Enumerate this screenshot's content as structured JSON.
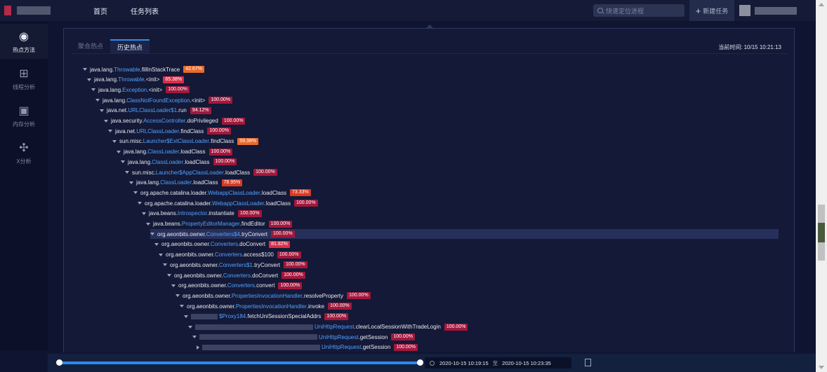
{
  "nav": {
    "home": "首页",
    "tasks": "任务列表"
  },
  "search": {
    "placeholder": "快速定位进程"
  },
  "new_task": "新建任务",
  "sidebar": [
    {
      "label": "热点方法",
      "icon": "hotspot-icon",
      "active": true
    },
    {
      "label": "线程分析",
      "icon": "thread-tree-icon",
      "active": false
    },
    {
      "label": "内存分析",
      "icon": "memory-icon",
      "active": false
    },
    {
      "label": "X分析",
      "icon": "x-analysis-icon",
      "active": false
    }
  ],
  "tabs": {
    "aggregate": "聚合热点",
    "history": "历史热点"
  },
  "current_time": {
    "label": "当前时间:",
    "value": "10/15 10:21:13"
  },
  "tree": [
    {
      "pre": "java.lang.",
      "cls": "Throwable",
      "m": ".fillInStackTrace",
      "pct": "42.67%",
      "color": "#e86a2c",
      "expanded": true
    },
    {
      "pre": "java.lang.",
      "cls": "Throwable",
      "m": ".<init>",
      "pct": "65.38%",
      "color": "#d92f4b",
      "expanded": true
    },
    {
      "pre": "java.lang.",
      "cls": "Exception",
      "m": ".<init>",
      "pct": "100.00%",
      "color": "#a2183c",
      "expanded": true
    },
    {
      "pre": "java.lang.",
      "cls": "ClassNotFoundException",
      "m": ".<init>",
      "pct": "100.00%",
      "color": "#a2183c",
      "expanded": true
    },
    {
      "pre": "java.net.",
      "cls": "URLClassLoader$1",
      "m": ".run",
      "pct": "94.12%",
      "color": "#a2183c",
      "expanded": true
    },
    {
      "pre": "java.security.",
      "cls": "AccessController",
      "m": ".doPrivileged",
      "pct": "100.00%",
      "color": "#a2183c",
      "expanded": true
    },
    {
      "pre": "java.net.",
      "cls": "URLClassLoader",
      "m": ".findClass",
      "pct": "100.00%",
      "color": "#a2183c",
      "expanded": true
    },
    {
      "pre": "sun.misc.",
      "cls": "Launcher$ExtClassLoader",
      "m": ".findClass",
      "pct": "59.38%",
      "color": "#e86a2c",
      "expanded": true
    },
    {
      "pre": "java.lang.",
      "cls": "ClassLoader",
      "m": ".loadClass",
      "pct": "100.00%",
      "color": "#a2183c",
      "expanded": true
    },
    {
      "pre": "java.lang.",
      "cls": "ClassLoader",
      "m": ".loadClass",
      "pct": "100.00%",
      "color": "#a2183c",
      "expanded": true
    },
    {
      "pre": "sun.misc.",
      "cls": "Launcher$AppClassLoader",
      "m": ".loadClass",
      "pct": "100.00%",
      "color": "#a2183c",
      "expanded": true
    },
    {
      "pre": "java.lang.",
      "cls": "ClassLoader",
      "m": ".loadClass",
      "pct": "78.95%",
      "color": "#d93a22",
      "expanded": true
    },
    {
      "pre": "org.apache.catalina.loader.",
      "cls": "WebappClassLoader",
      "m": ".loadClass",
      "pct": "73.33%",
      "color": "#d93a22",
      "expanded": true
    },
    {
      "pre": "org.apache.catalina.loader.",
      "cls": "WebappClassLoader",
      "m": ".loadClass",
      "pct": "100.00%",
      "color": "#a2183c",
      "expanded": true
    },
    {
      "pre": "java.beans.",
      "cls": "Introspector",
      "m": ".instantiate",
      "pct": "100.00%",
      "color": "#a2183c",
      "expanded": true
    },
    {
      "pre": "java.beans.",
      "cls": "PropertyEditorManager",
      "m": ".findEditor",
      "pct": "100.00%",
      "color": "#a2183c",
      "expanded": true
    },
    {
      "pre": "org.aeonbits.owner.",
      "cls": "Converters$4",
      "m": ".tryConvert",
      "pct": "100.00%",
      "color": "#a2183c",
      "expanded": true,
      "highlight": true
    },
    {
      "pre": "org.aeonbits.owner.",
      "cls": "Converters",
      "m": ".doConvert",
      "pct": "81.82%",
      "color": "#d92f4b",
      "expanded": true
    },
    {
      "pre": "org.aeonbits.owner.",
      "cls": "Converters",
      "m": ".access$100",
      "pct": "100.00%",
      "color": "#a2183c",
      "expanded": true
    },
    {
      "pre": "org.aeonbits.owner.",
      "cls": "Converters$1",
      "m": ".tryConvert",
      "pct": "100.00%",
      "color": "#a2183c",
      "expanded": true
    },
    {
      "pre": "org.aeonbits.owner.",
      "cls": "Converters",
      "m": ".doConvert",
      "pct": "100.00%",
      "color": "#a2183c",
      "expanded": true
    },
    {
      "pre": "org.aeonbits.owner.",
      "cls": "Converters",
      "m": ".convert",
      "pct": "100.00%",
      "color": "#a2183c",
      "expanded": true
    },
    {
      "pre": "org.aeonbits.owner.",
      "cls": "PropertiesInvocationHandler",
      "m": ".resolveProperty",
      "pct": "100.00%",
      "color": "#a2183c",
      "expanded": true
    },
    {
      "pre": "org.aeonbits.owner.",
      "cls": "PropertiesInvocationHandler",
      "m": ".invoke",
      "pct": "100.00%",
      "color": "#a2183c",
      "expanded": true
    },
    {
      "pre": "",
      "cls": "$Proxy184",
      "m": ".fetchUniSessionSpecialAddrs",
      "pct": "100.00%",
      "color": "#a2183c",
      "expanded": true,
      "blur": 38
    },
    {
      "pre": "",
      "cls": "UniHttpRequest",
      "m": ".clearLocalSessionWithTradeLogin",
      "pct": "100.00%",
      "color": "#a2183c",
      "expanded": true,
      "blur": 168
    },
    {
      "pre": "",
      "cls": "UniHttpRequest",
      "m": ".getSession",
      "pct": "100.00%",
      "color": "#a2183c",
      "expanded": true,
      "blur": 168
    },
    {
      "pre": "",
      "cls": "UniHttpRequest",
      "m": ".getSession",
      "pct": "100.00%",
      "color": "#a2183c",
      "expanded": false,
      "blur": 168
    }
  ],
  "timeline": {
    "start": "2020-10-15 10:19:15",
    "separator": "至",
    "end": "2020-10-15 10:23:35"
  }
}
